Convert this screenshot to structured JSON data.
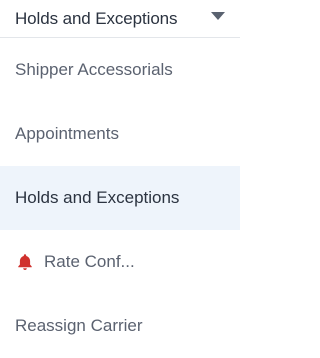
{
  "dropdown": {
    "selected_label": "Holds and Exceptions",
    "caret_icon": "caret-down-icon"
  },
  "menu": {
    "items": [
      {
        "label": "Shipper Accessorials",
        "selected": false
      },
      {
        "label": "Appointments",
        "selected": false
      },
      {
        "label": "Holds and Exceptions",
        "selected": true
      },
      {
        "label": "Rate Conf...",
        "selected": false,
        "icon": "bell-icon",
        "icon_color": "#d0312d"
      },
      {
        "label": "Reassign Carrier",
        "selected": false
      }
    ]
  },
  "colors": {
    "selected_background": "#eef4fb",
    "text_primary": "#2b3340",
    "text_secondary": "#5b6270",
    "divider": "#e3e6ea"
  }
}
